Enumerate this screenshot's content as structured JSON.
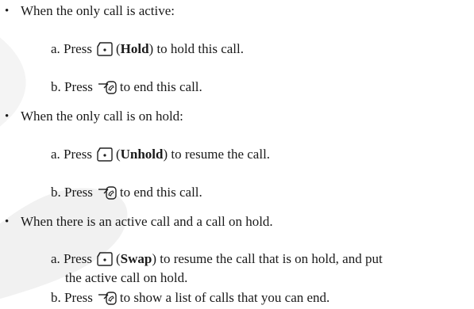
{
  "items": [
    {
      "bullet": "•",
      "text": "When the only call is active:",
      "steps": [
        {
          "letter": "a.",
          "pre": "Press",
          "icon": "left-softkey-icon",
          "open": "(",
          "key": "Hold",
          "close": ")",
          "post": "to hold this call."
        },
        {
          "letter": "b.",
          "pre": "Press",
          "icon": "end-call-icon",
          "post": "to end this call."
        }
      ]
    },
    {
      "bullet": "•",
      "text": "When the only call is on hold:",
      "steps": [
        {
          "letter": "a.",
          "pre": "Press",
          "icon": "left-softkey-icon",
          "open": "(",
          "key": "Unhold",
          "close": ")",
          "post": "to resume the call."
        },
        {
          "letter": "b.",
          "pre": "Press",
          "icon": "end-call-icon",
          "post": "to end this call."
        }
      ]
    },
    {
      "bullet": "•",
      "text": "When there is an active call and a call on hold.",
      "steps": [
        {
          "letter": "a.",
          "pre": "Press",
          "icon": "left-softkey-icon",
          "open": "(",
          "key": "Swap",
          "close": ")",
          "post": "to resume the call that is on hold, and put",
          "cont": "the active call on hold."
        },
        {
          "letter": "b.",
          "pre": "Press",
          "icon": "end-call-icon",
          "post": "to show a list of calls that you can end."
        }
      ]
    }
  ]
}
